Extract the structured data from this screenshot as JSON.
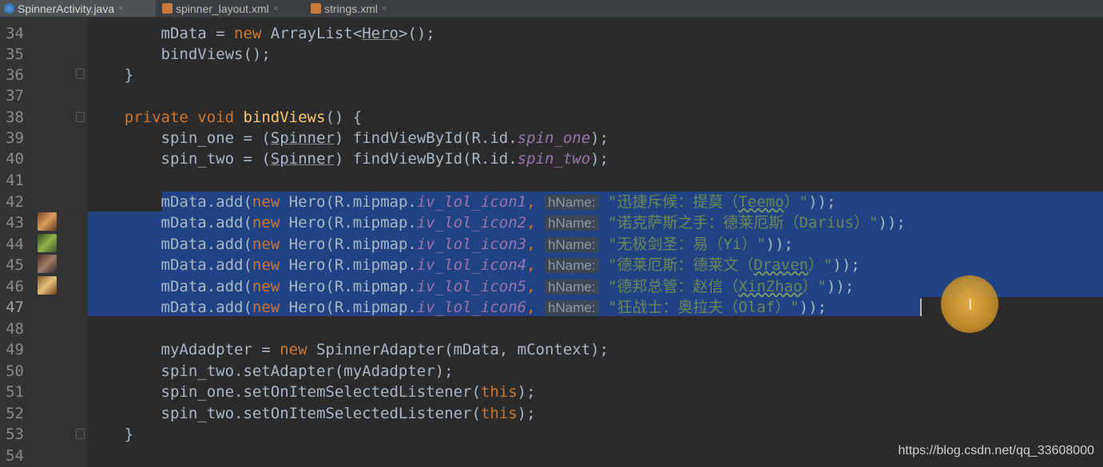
{
  "tabs": [
    {
      "label": "SpinnerActivity.java",
      "icon": "java-class-icon",
      "active": true
    },
    {
      "label": "spinner_layout.xml",
      "icon": "xml-file-icon",
      "active": false
    },
    {
      "label": "strings.xml",
      "icon": "xml-file-icon",
      "active": false
    }
  ],
  "close_glyph": "×",
  "line_numbers": [
    "34",
    "35",
    "36",
    "37",
    "38",
    "39",
    "40",
    "41",
    "42",
    "43",
    "44",
    "45",
    "46",
    "47",
    "48",
    "49",
    "50",
    "51",
    "52",
    "53",
    "54"
  ],
  "code": {
    "l34": {
      "a": "mData = ",
      "kw": "new",
      "b": " ArrayList<",
      "hero": "Hero",
      "c": ">();"
    },
    "l35": "bindViews();",
    "l36": "}",
    "l38": {
      "mod": "private void ",
      "fn": "bindViews",
      "rest": "() {"
    },
    "l39": {
      "a": "spin_one = (",
      "cls": "Spinner",
      "b": ") findViewById(R.id.",
      "id": "spin_one",
      "c": ");"
    },
    "l40": {
      "a": "spin_two = (",
      "cls": "Spinner",
      "b": ") findViewById(R.id.",
      "id": "spin_two",
      "c": ");"
    },
    "add_prefix": "mData.add(",
    "new_kw": "new",
    "hero_ctor": " Hero(R.mipmap.",
    "hint_label": "hName:",
    "heroes": [
      {
        "icon": "iv_lol_icon1",
        "s1": "\"迅捷斥候：提莫（",
        "s2": "Teemo",
        "s3": "）\"",
        "tail": "));"
      },
      {
        "icon": "iv_lol_icon2",
        "s1": "\"诺克萨斯之手：德莱厄斯（",
        "s2": "Darius",
        "s3": "）\"",
        "tail": "));"
      },
      {
        "icon": "iv_lol_icon3",
        "s1": "\"无极剑圣：易（",
        "s2": "Yi",
        "s3": "）\"",
        "tail": "));"
      },
      {
        "icon": "iv_lol_icon4",
        "s1": "\"德莱厄斯：德莱文（",
        "s2": "Draven",
        "s3": "）\"",
        "tail": "));"
      },
      {
        "icon": "iv_lol_icon5",
        "s1": "\"德邦总管：赵信（",
        "s2": "XinZhao",
        "s3": "）\"",
        "tail": "));"
      },
      {
        "icon": "iv_lol_icon6",
        "s1": "\"狂战士：奥拉夫（",
        "s2": "Olaf",
        "s3": "）\"",
        "tail": "));"
      }
    ],
    "l49": {
      "a": "myAdadpter = ",
      "kw": "new",
      "b": " SpinnerAdapter(mData, mContext);"
    },
    "l50": "spin_two.setAdapter(myAdadpter);",
    "l51": {
      "a": "spin_one.setOnItemSelectedListener(",
      "kw": "this",
      "c": ");"
    },
    "l52": {
      "a": "spin_two.setOnItemSelectedListener(",
      "kw": "this",
      "c": ");"
    },
    "l53": "}"
  },
  "gutter_icons": [
    "hero-avatar-draven-icon",
    "hero-avatar-teemo-icon",
    "hero-avatar-yi-icon",
    "hero-avatar-xinzhao-icon"
  ],
  "cursor_glyph": "I",
  "watermark": "https://blog.csdn.net/qq_33608000",
  "colors": {
    "background": "#2b2b2b",
    "selection": "#214283",
    "keyword": "#cc7832",
    "string": "#6a8759"
  }
}
